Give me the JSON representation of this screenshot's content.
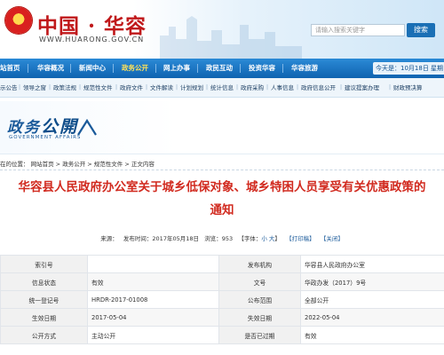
{
  "header": {
    "site_name": "中国 · 华容",
    "site_url": "WWW.HUARONG.GOV.CN",
    "search": {
      "placeholder": "请输入搜索关键字",
      "button": "搜索"
    }
  },
  "mainnav": {
    "items": [
      "站首页",
      "华容概况",
      "新闻中心",
      "政务公开",
      "网上办事",
      "政民互动",
      "投资华容",
      "华容旅游"
    ],
    "active_index": 3,
    "date_text": "今天是：10月18日 星期"
  },
  "subnav": {
    "items": [
      "示公告",
      "领导之窗",
      "政策法规",
      "规范性文件",
      "政府文件",
      "文件解读",
      "计划规划",
      "统计信息",
      "政府采购",
      "人事信息",
      "政府信息公开",
      "建议提案办理",
      "财政预决算"
    ]
  },
  "banner": {
    "title_a": "政务",
    "title_b": "公開",
    "subtitle": "GOVERNMENT AFFAIRS"
  },
  "breadcrumb": {
    "prefix": "在的位置：",
    "items": [
      "网站首页",
      "政务公开",
      "规范性文件",
      "正文内容"
    ],
    "sep": ">"
  },
  "article": {
    "title_line1": "华容县人民政府办公室关于城乡低保对象、城乡特困人员享受有关优惠政策的",
    "title_line2": "通知",
    "meta": {
      "source_label": "来源：",
      "source_value": "",
      "date_label": "发布时间：",
      "date_value": "2017年05月18日",
      "views_label": "浏览：",
      "views_value": "953",
      "font_label": "【字体：",
      "font_small": "小",
      "font_large": "大",
      "font_end": "】",
      "print_label": "【打印稿】",
      "close_label": "【关闭】"
    },
    "info_rows": [
      [
        "索引号",
        "",
        "发布机构",
        "华容县人民政府办公室"
      ],
      [
        "信息状态",
        "有效",
        "文号",
        "华政办发（2017）9号"
      ],
      [
        "统一登记号",
        "HRDR-2017-01008",
        "公布范围",
        "全部公开"
      ],
      [
        "生效日期",
        "2017-05-04",
        "失效日期",
        "2022-05-04"
      ],
      [
        "公开方式",
        "主动公开",
        "是否已过期",
        "有效"
      ]
    ]
  },
  "colors": {
    "nav_blue": "#0f63b0",
    "title_red": "#d12a1f",
    "brand_red": "#c0181a",
    "active_nav": "#ffe25a"
  }
}
